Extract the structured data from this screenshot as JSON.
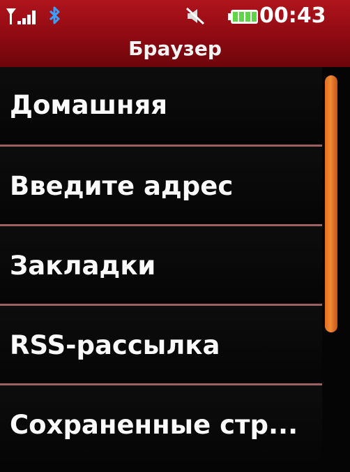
{
  "status_bar": {
    "time": "00:43",
    "icons": [
      "signal-icon",
      "bluetooth-icon",
      "mute-icon",
      "battery-icon"
    ]
  },
  "header": {
    "title": "Браузер"
  },
  "menu": {
    "items": [
      {
        "label": "Домашняя"
      },
      {
        "label": "Введите адрес"
      },
      {
        "label": "Закладки"
      },
      {
        "label": "RSS-рассылка"
      },
      {
        "label": "Сохраненные стр..."
      }
    ]
  },
  "colors": {
    "header": "#9e0f17",
    "background": "#050505",
    "divider": "#9b6060",
    "scrollbar": "#e87a28",
    "battery": "#5fd54a",
    "text": "#fafafa"
  }
}
